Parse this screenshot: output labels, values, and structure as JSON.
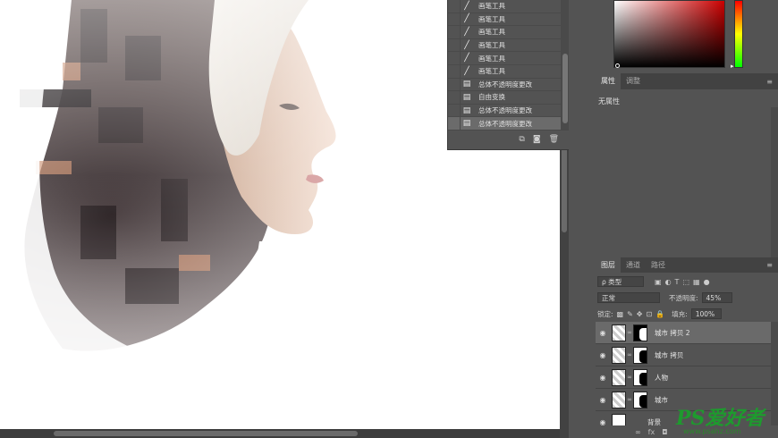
{
  "history": {
    "items": [
      {
        "label": "画笔工具",
        "icon": "brush-icon"
      },
      {
        "label": "画笔工具",
        "icon": "brush-icon"
      },
      {
        "label": "画笔工具",
        "icon": "brush-icon"
      },
      {
        "label": "画笔工具",
        "icon": "brush-icon"
      },
      {
        "label": "画笔工具",
        "icon": "brush-icon"
      },
      {
        "label": "画笔工具",
        "icon": "brush-icon"
      },
      {
        "label": "总体不透明度更改",
        "icon": "document-icon"
      },
      {
        "label": "自由变换",
        "icon": "document-icon"
      },
      {
        "label": "总体不透明度更改",
        "icon": "document-icon"
      },
      {
        "label": "总体不透明度更改",
        "icon": "document-icon"
      }
    ]
  },
  "properties": {
    "tabs": [
      "属性",
      "调整"
    ],
    "empty_label": "无属性"
  },
  "layers": {
    "tabs": [
      "图层",
      "通道",
      "路径"
    ],
    "filter_kind": "ρ 类型",
    "blend_mode": "正常",
    "opacity_label": "不透明度:",
    "opacity_value": "45%",
    "lock_label": "锁定:",
    "fill_label": "填充:",
    "fill_value": "100%",
    "items": [
      {
        "name": "城市 拷贝 2",
        "selected": true
      },
      {
        "name": "城市 拷贝",
        "selected": false
      },
      {
        "name": "人物",
        "selected": false
      },
      {
        "name": "城市",
        "selected": false
      },
      {
        "name": "背景",
        "selected": false
      }
    ]
  },
  "watermark": {
    "logo": "PS爱好者",
    "url": "www.psahz.com"
  },
  "colors": {
    "app_bg": "#535353",
    "panel_tab_bg": "#424242",
    "selected_row": "#6b6b6b",
    "watermark_green": "#1e9a2e"
  }
}
